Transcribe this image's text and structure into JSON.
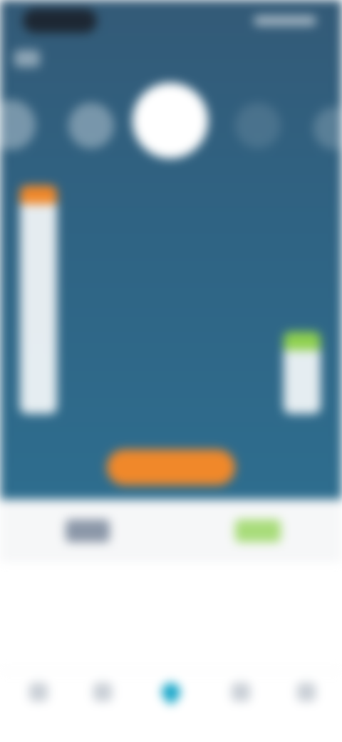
{
  "header": {
    "week_label": ""
  },
  "days": [
    {
      "label": ""
    },
    {
      "label": ""
    },
    {
      "label": "",
      "active": true
    },
    {
      "label": ""
    },
    {
      "label": ""
    }
  ],
  "bars": {
    "left": {
      "caption": "",
      "fill_fraction": 1.0,
      "cap_color": "#f0882a"
    },
    "right": {
      "caption": "",
      "fill_fraction": 0.36,
      "cap_color": "#8fd14f"
    }
  },
  "cta": {
    "label": ""
  },
  "tabs": {
    "left": "",
    "right": ""
  },
  "description": {
    "text": ""
  },
  "bottom_nav": {
    "items": [
      {
        "label": "",
        "icon": "home-icon"
      },
      {
        "label": "",
        "icon": "list-icon"
      },
      {
        "label": "",
        "icon": "pin-icon",
        "active": true
      },
      {
        "label": "",
        "icon": "chart-icon"
      },
      {
        "label": "",
        "icon": "user-icon"
      }
    ]
  },
  "colors": {
    "top_background": "#2f6383",
    "accent_orange": "#f0882a",
    "accent_green": "#8fd14f",
    "nav_active": "#1aa7c9"
  }
}
